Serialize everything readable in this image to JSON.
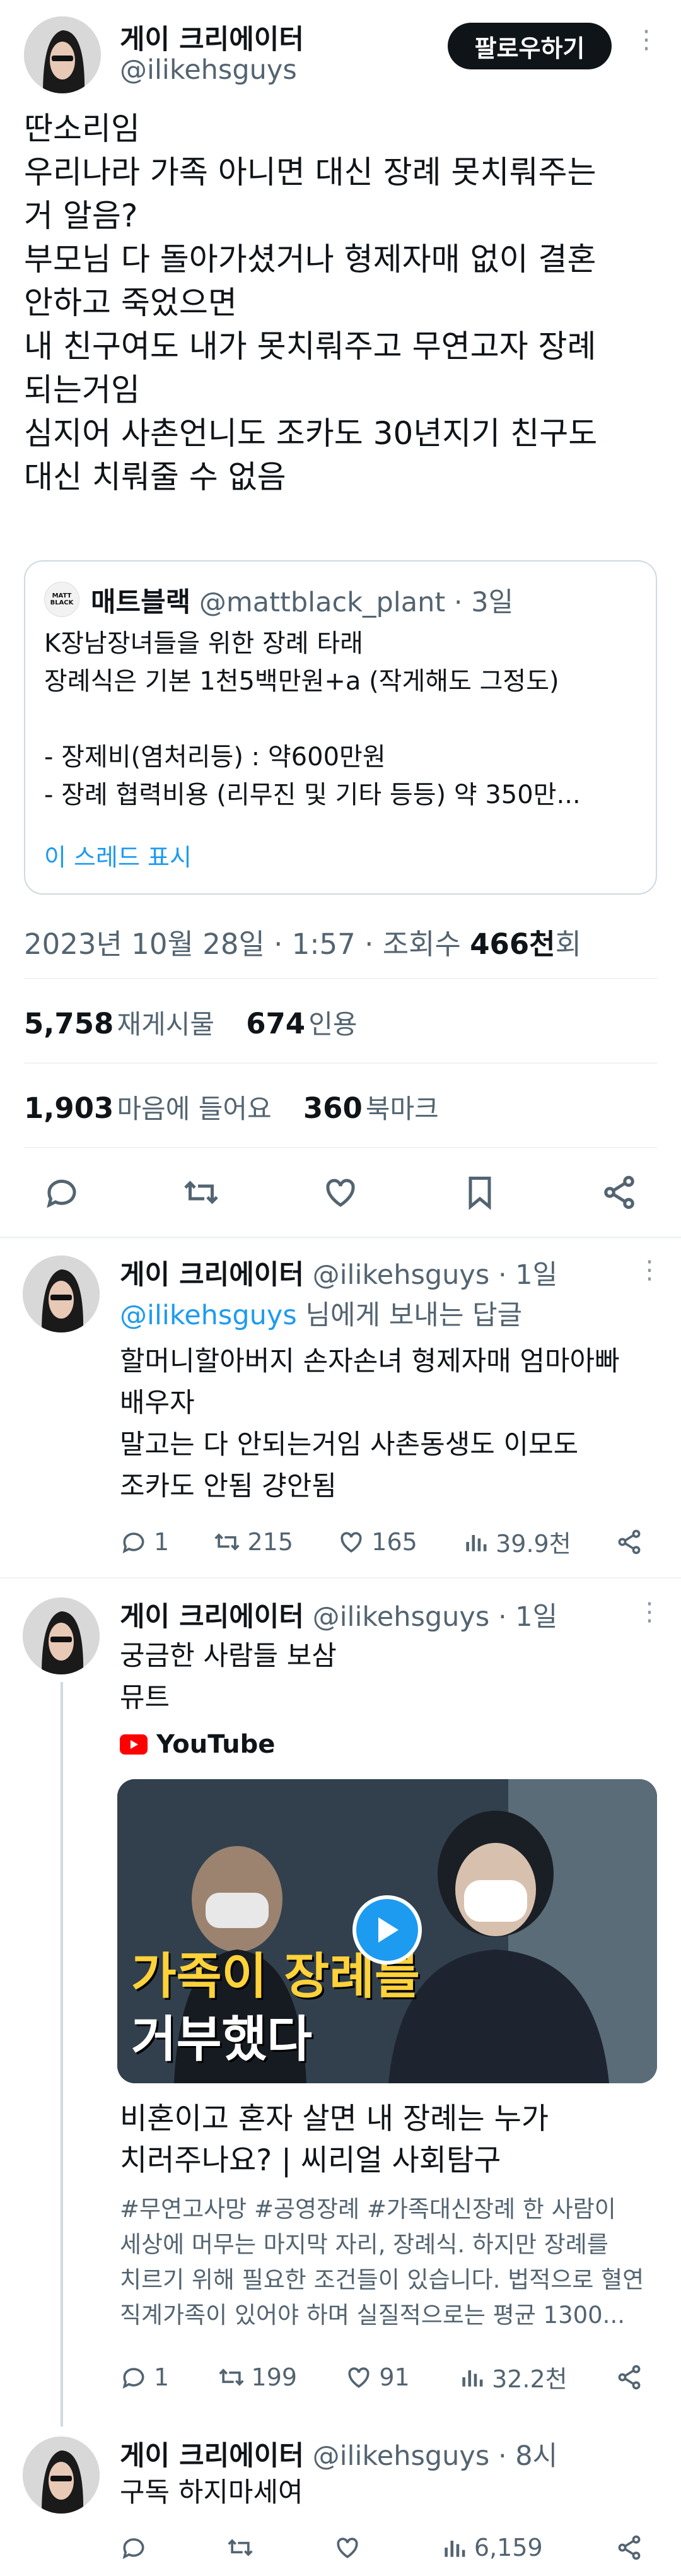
{
  "colors": {
    "accent": "#1d9bf0",
    "text": "#0f1419",
    "muted": "#536471",
    "youtube": "#ff0000"
  },
  "main_tweet": {
    "author_name": "게이 크리에이터",
    "author_handle": "@ilikehsguys",
    "follow_label": "팔로우하기",
    "lines": [
      "딴소리임",
      "우리나라 가족 아니면 대신 장례 못치뤄주는",
      "거 알음?",
      "부모님 다 돌아가셨거나 형제자매 없이 결혼",
      "안하고 죽었으면",
      "내 친구여도 내가 못치뤄주고 무연고자 장례",
      "되는거임",
      "심지어 사촌언니도 조카도 30년지기 친구도",
      "대신 치뤄줄 수 없음"
    ],
    "quote": {
      "logo_text": "MATT BLACK",
      "author_name": "매트블랙",
      "author_handle": "@mattblack_plant",
      "time": "· 3일",
      "lines": [
        "K장남장녀들을 위한 장례 타래",
        "장례식은 기본 1천5백만원+a  (작게해도 그정도)",
        "",
        "- 장제비(염처리등) : 약600만원",
        "- 장례 협력비용 (리무진 및 기타 등등) 약 350만..."
      ],
      "show_thread": "이 스레드 표시"
    },
    "timestamp": "2023년 10월 28일 · 1:57 · 조회수 ",
    "views": "466천",
    "views_suffix": "회",
    "retweets": "5,758",
    "retweets_label": "재게시물",
    "quotes": "674",
    "quotes_label": "인용",
    "likes": "1,903",
    "likes_label": "마음에 들어요",
    "bookmarks": "360",
    "bookmarks_label": "북마크"
  },
  "replies": [
    {
      "author_name": "게이 크리에이터",
      "author_handle": "@ilikehsguys",
      "time": "· 1일",
      "reply_to_handle": "@ilikehsguys",
      "reply_to_suffix": " 님에게 보내는 답글",
      "lines": [
        "할머니할아버지 손자손녀 형제자매 엄마아빠",
        "배우자",
        "말고는 다 안되는거임 사촌동생도 이모도",
        "조카도 안됨 걍안됨"
      ],
      "stats": {
        "replies": "1",
        "retweets": "215",
        "likes": "165",
        "views": "39.9천"
      }
    },
    {
      "author_name": "게이 크리에이터",
      "author_handle": "@ilikehsguys",
      "time": "· 1일",
      "lines": [
        "궁금한 사람들 보삼",
        "뮤트"
      ],
      "card": {
        "source": "YouTube",
        "thumb_text_1": "가족이 장례를",
        "thumb_text_2": "거부했다",
        "title_lines": [
          "비혼이고 혼자 살면 내 장례는 누가",
          "치러주나요? | 씨리얼 사회탐구"
        ],
        "desc_lines": [
          "#무연고사망 #공영장례 #가족대신장례 한 사람이",
          "세상에 머무는 마지막 자리, 장례식. 하지만 장례를",
          "치르기 위해 필요한 조건들이 있습니다. 법적으로 혈연",
          "직계가족이 있어야 하며 실질적으로는 평균 1300..."
        ]
      },
      "stats": {
        "replies": "1",
        "retweets": "199",
        "likes": "91",
        "views": "32.2천"
      }
    },
    {
      "author_name": "게이 크리에이터",
      "author_handle": "@ilikehsguys",
      "time": "· 8시",
      "lines": [
        "구독 하지마세여"
      ],
      "stats": {
        "replies": "",
        "retweets": "",
        "likes": "",
        "views": "6,159"
      }
    }
  ]
}
